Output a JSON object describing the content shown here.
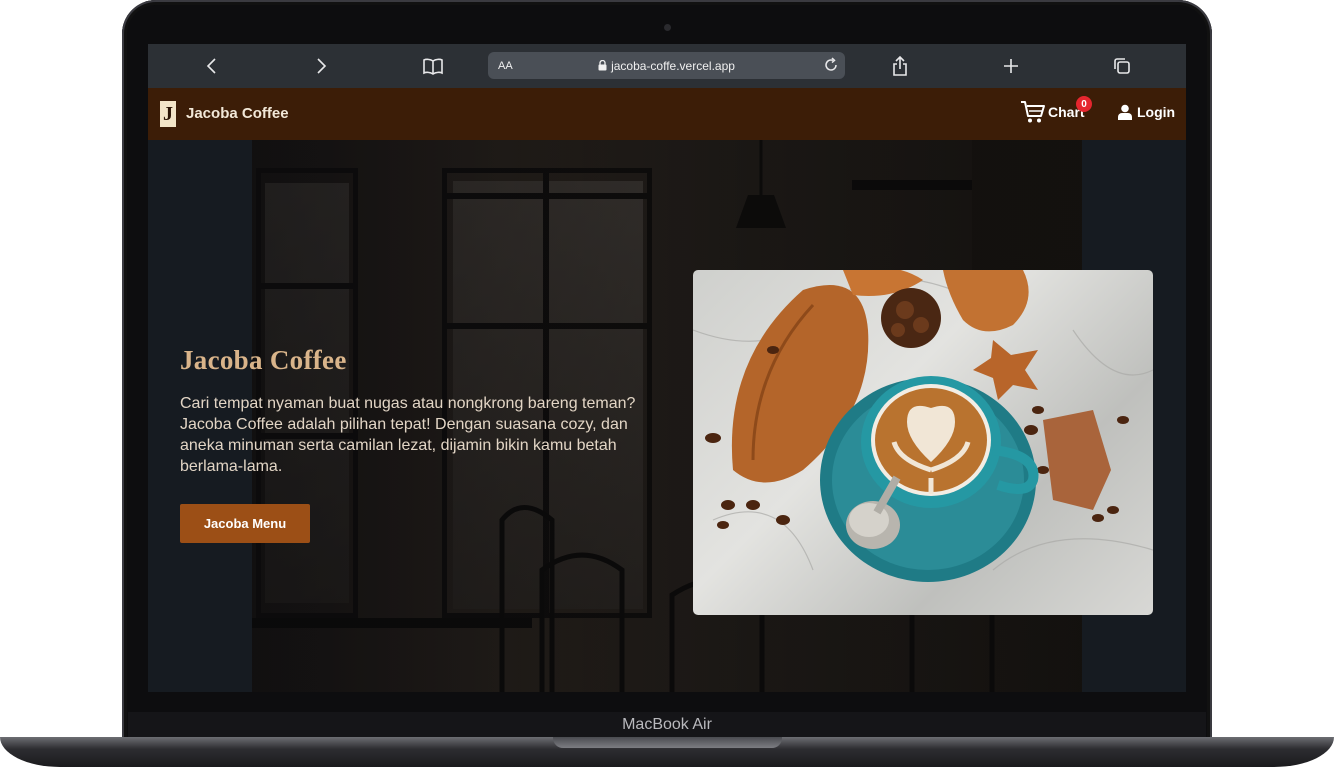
{
  "device": {
    "brand_label": "MacBook Air"
  },
  "browser": {
    "url": "jacoba-coffe.vercel.app",
    "text_size_label": "AA",
    "icons": [
      "back-icon",
      "forward-icon",
      "bookmarks-icon",
      "lock-icon",
      "reload-icon",
      "share-icon",
      "new-tab-icon",
      "tabs-icon"
    ]
  },
  "navbar": {
    "logo_letter": "J",
    "site_title": "Jacoba Coffee",
    "cart_label": "Chart",
    "cart_count": "0",
    "login_label": "Login"
  },
  "hero": {
    "title": "Jacoba Coffee",
    "description": "Cari tempat nyaman buat nugas atau nongkrong bareng teman? Jacoba Coffee adalah pilihan tepat! Dengan suasana cozy, dan aneka minuman serta camilan lezat, dijamin bikin kamu betah berlama-lama.",
    "cta_label": "Jacoba Menu"
  },
  "colors": {
    "navbar_bg": "#3c1d07",
    "accent": "#9c4f16",
    "hero_title": "#d9b48a",
    "badge": "#e5262e"
  }
}
